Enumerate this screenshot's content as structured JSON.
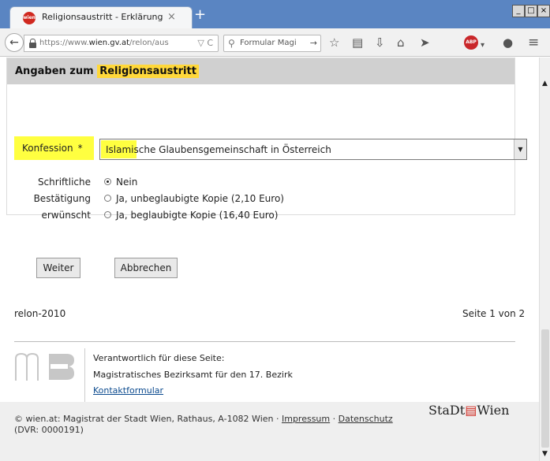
{
  "browser": {
    "tab_title": "Religionsaustritt - Erklärung",
    "tab_favicon_text": "wien",
    "tab_close": "×",
    "new_tab": "+",
    "window_buttons": [
      "_",
      "□",
      "×"
    ],
    "url_prefix": "https://www.",
    "url_domain": "wien.gv.at",
    "url_rest": "/relon/aus",
    "url_extra": "▽ C",
    "search_placeholder": "Formular Magi",
    "search_go": "→",
    "adblock_label": "ABP"
  },
  "form": {
    "title_prefix": "Angaben zum ",
    "title_highlight": "Religionsaustritt",
    "konfession_label": "Konfession",
    "required_marker": "*",
    "konfession_value": "Islamische Glaubensgemeinschaft in Österreich",
    "confirmation_label_lines": [
      "Schriftliche",
      "Bestätigung",
      "erwünscht"
    ],
    "confirmation_options": [
      {
        "label": "Nein",
        "checked": true
      },
      {
        "label": "Ja, unbeglaubigte Kopie (2,10 Euro)",
        "checked": false
      },
      {
        "label": "Ja, beglaubigte Kopie (16,40 Euro)",
        "checked": false
      }
    ],
    "next_button": "Weiter",
    "cancel_button": "Abbrechen"
  },
  "page_footer": {
    "form_id": "relon-2010",
    "page_counter": "Seite 1 von 2",
    "responsible_heading": "Verantwortlich für diese Seite:",
    "responsible_office": "Magistratisches Bezirksamt für den 17. Bezirk",
    "contact_link": "Kontaktformular"
  },
  "site_footer": {
    "copyright": "© wien.at: Magistrat der Stadt Wien, Rathaus, A-1082 Wien ·",
    "impressum_link": "Impressum",
    "separator": "·",
    "datenschutz_link": "Datenschutz",
    "dvr": "(DVR: 0000191)",
    "logo_text_a": "StaDt",
    "logo_text_b": "Wien"
  },
  "colors": {
    "highlight_yellow": "#ffff40",
    "title_highlight": "#ffd83a",
    "header_gray": "#d0d0d0",
    "titlebar_blue": "#5a85c2",
    "link_blue": "#0b4a8e"
  }
}
